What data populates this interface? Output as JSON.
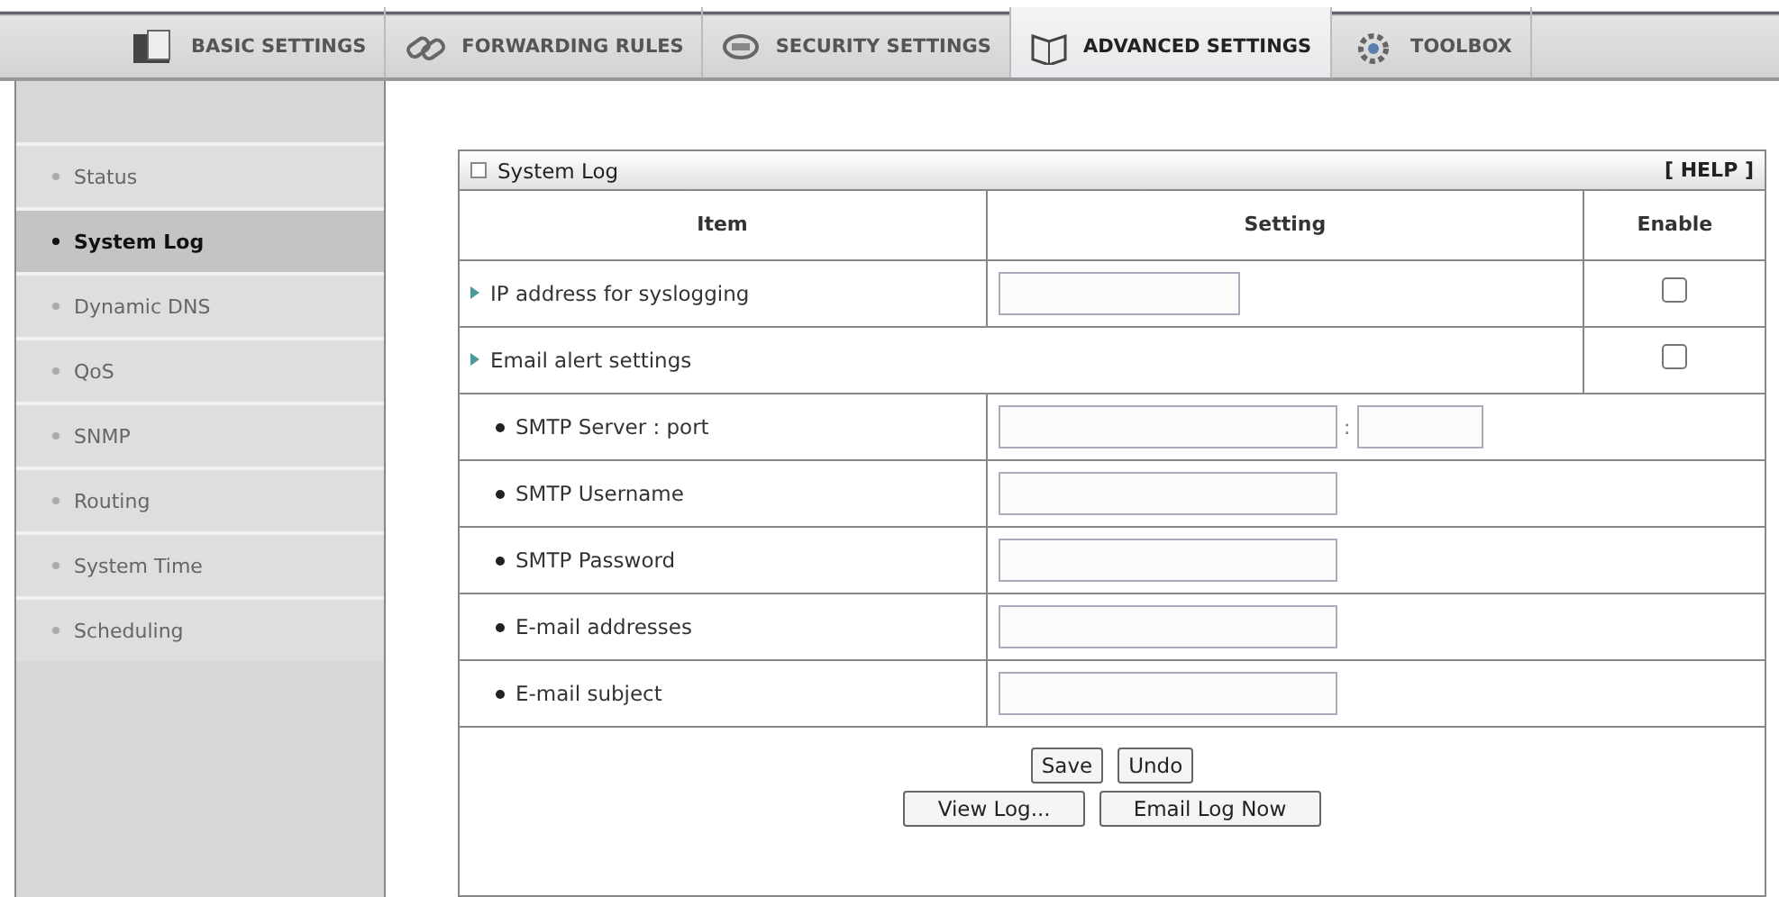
{
  "tabs": [
    {
      "label": "BASIC SETTINGS",
      "selected": false
    },
    {
      "label": "FORWARDING RULES",
      "selected": false
    },
    {
      "label": "SECURITY SETTINGS",
      "selected": false
    },
    {
      "label": "ADVANCED SETTINGS",
      "selected": true
    },
    {
      "label": "TOOLBOX",
      "selected": false
    }
  ],
  "sidebar": {
    "items": [
      {
        "label": "Status",
        "selected": false
      },
      {
        "label": "System Log",
        "selected": true
      },
      {
        "label": "Dynamic DNS",
        "selected": false
      },
      {
        "label": "QoS",
        "selected": false
      },
      {
        "label": "SNMP",
        "selected": false
      },
      {
        "label": "Routing",
        "selected": false
      },
      {
        "label": "System Time",
        "selected": false
      },
      {
        "label": "Scheduling",
        "selected": false
      }
    ]
  },
  "panel": {
    "title": "System Log",
    "help": "[ HELP ]",
    "columns": [
      "Item",
      "Setting",
      "Enable"
    ],
    "rows": [
      {
        "kind": "main",
        "label": "IP address for syslogging",
        "checked": false
      },
      {
        "kind": "group",
        "label": "Email alert settings",
        "checked": false
      },
      {
        "kind": "pair",
        "label": "SMTP Server : port",
        "separator": ":"
      },
      {
        "kind": "sub",
        "label": "SMTP Username"
      },
      {
        "kind": "sub",
        "label": "SMTP Password"
      },
      {
        "kind": "sub",
        "label": "E-mail addresses"
      },
      {
        "kind": "sub",
        "label": "E-mail subject"
      }
    ],
    "buttons": [
      [
        "Save",
        "Undo"
      ],
      [
        "View Log...",
        "Email Log Now"
      ]
    ]
  }
}
